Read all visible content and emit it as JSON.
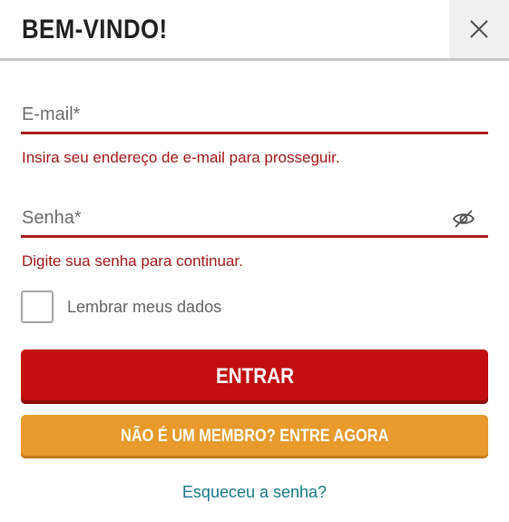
{
  "header": {
    "title": "BEM-VINDO!",
    "close_icon": "close-icon"
  },
  "form": {
    "email": {
      "placeholder": "E-mail*",
      "value": "",
      "error": "Insira seu endereço de e-mail para prosseguir."
    },
    "password": {
      "placeholder": "Senha*",
      "value": "",
      "toggle_icon": "eye-slash-icon",
      "error": "Digite sua senha para continuar."
    },
    "remember": {
      "label": "Lembrar meus dados",
      "checked": false
    }
  },
  "actions": {
    "login_label": "ENTRAR",
    "join_label": "NÃO É UM MEMBRO? ENTRE AGORA",
    "forgot_label": "Esqueceu a senha?"
  },
  "colors": {
    "primary_red": "#c20e0e",
    "error_red": "#a91b1b",
    "join_orange": "#e89a2c",
    "link_teal": "#1b7b8c"
  }
}
